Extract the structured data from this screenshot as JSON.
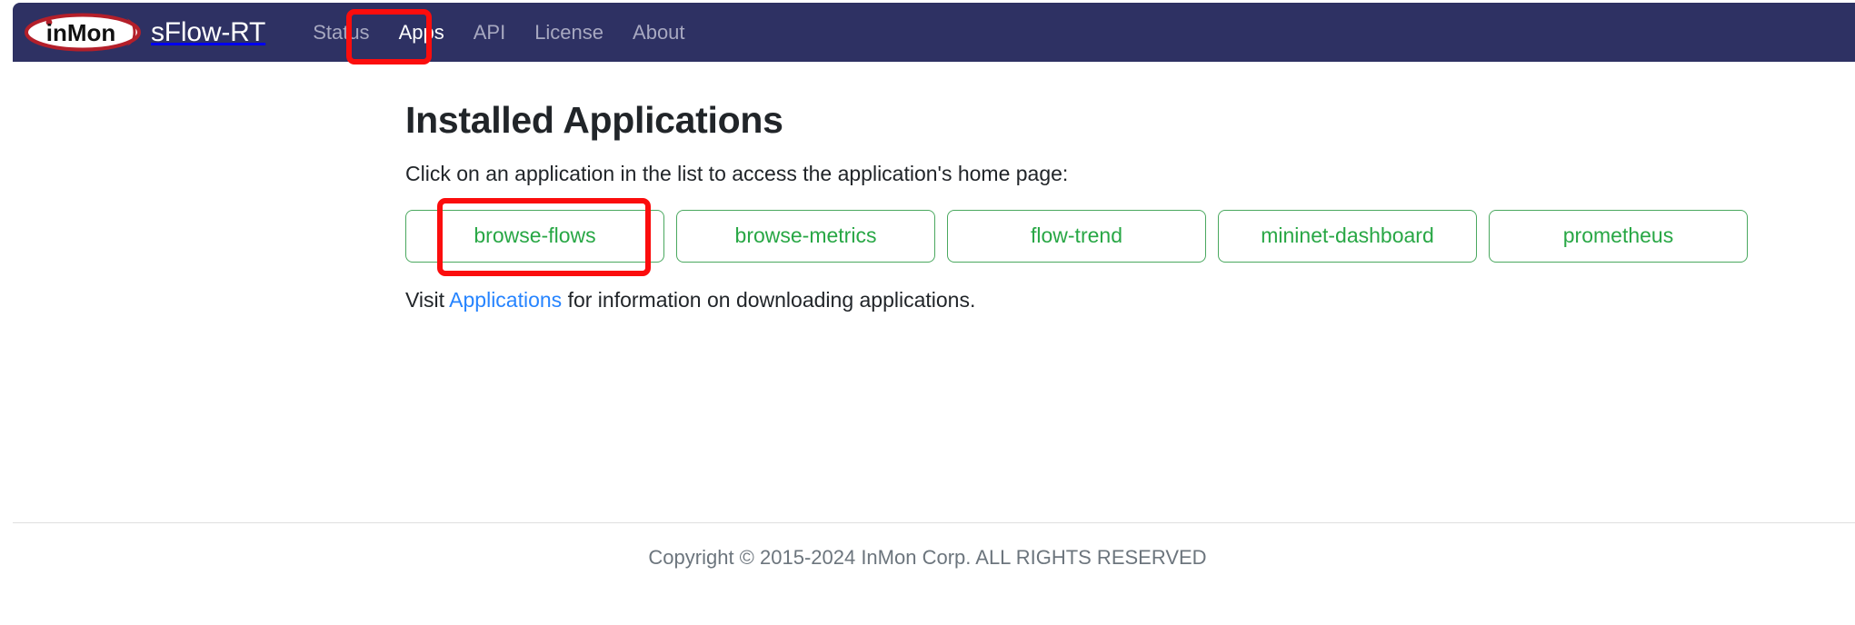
{
  "navbar": {
    "logo_text": "inMon",
    "logo_icon": "inmon-oval-logo",
    "brand_name": "sFlow-RT",
    "links": [
      {
        "label": "Status",
        "active": false
      },
      {
        "label": "Apps",
        "active": true
      },
      {
        "label": "API",
        "active": false
      },
      {
        "label": "License",
        "active": false
      },
      {
        "label": "About",
        "active": false
      }
    ]
  },
  "main": {
    "title": "Installed Applications",
    "lede": "Click on an application in the list to access the application's home page:",
    "apps": [
      {
        "label": "browse-flows"
      },
      {
        "label": "browse-metrics"
      },
      {
        "label": "flow-trend"
      },
      {
        "label": "mininet-dashboard"
      },
      {
        "label": "prometheus"
      }
    ],
    "visit": {
      "prefix": "Visit ",
      "link_label": "Applications",
      "suffix": " for information on downloading applications."
    }
  },
  "footer": {
    "copyright": "Copyright © 2015-2024 InMon Corp. ALL RIGHTS RESERVED"
  },
  "annotations": [
    {
      "name": "apps-nav-highlight",
      "target": "Apps"
    },
    {
      "name": "browse-flows-highlight",
      "target": "browse-flows"
    }
  ],
  "colors": {
    "navbar_bg": "#2e3163",
    "nav_link": "#a7a8c0",
    "nav_link_active": "#ffffff",
    "app_button_text": "#28a745",
    "app_button_border": "#4aa85f",
    "link": "#2684ff",
    "footer_text": "#6c757d",
    "annotation": "#fb0d0d",
    "logo_red": "#b41f2a"
  }
}
